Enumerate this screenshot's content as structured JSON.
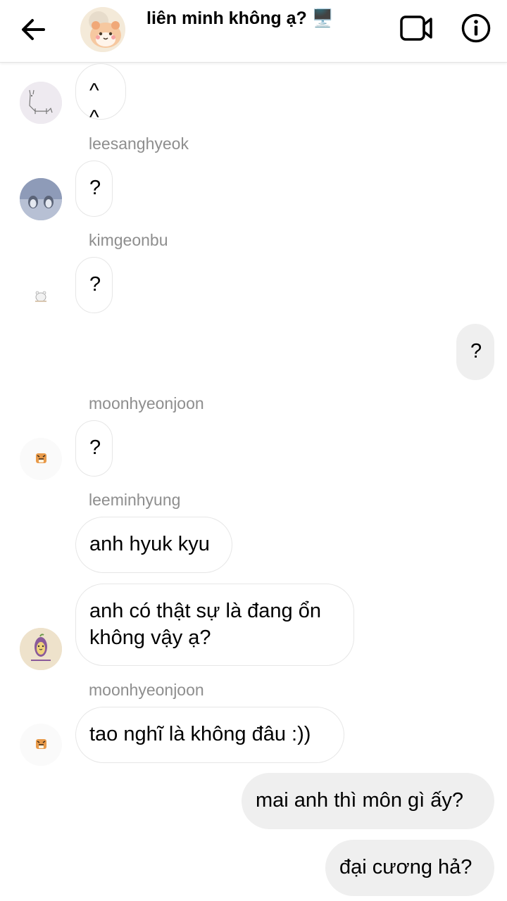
{
  "header": {
    "back_icon": "arrow-left-icon",
    "group_avatar_icon": "hamster-avatar-icon",
    "title": "liên minh không ạ? 🖥️",
    "subtitle": "",
    "video_icon": "video-call-icon",
    "info_icon": "info-icon"
  },
  "messages": [
    {
      "text": "^ ^",
      "direction": "incoming",
      "avatar_icon": "alpaca-avatar-icon"
    },
    {
      "sender": "leesanghyeok",
      "text": "?",
      "direction": "incoming",
      "avatar_icon": "penguins-avatar-icon"
    },
    {
      "sender": "kimgeonbu",
      "text": "?",
      "direction": "incoming",
      "avatar_icon": "white-bear-avatar-icon"
    },
    {
      "text": "?",
      "direction": "outgoing"
    },
    {
      "sender": "moonhyeonjoon",
      "text": "?",
      "direction": "incoming",
      "avatar_icon": "tiger-avatar-icon"
    },
    {
      "sender": "leeminhyung",
      "text": "anh hyuk kyu",
      "direction": "incoming"
    },
    {
      "text": "anh có thật sự là đang ổn không vậy ạ?",
      "direction": "incoming",
      "avatar_icon": "sweet-potato-avatar-icon"
    },
    {
      "sender": "moonhyeonjoon",
      "text": "tao nghĩ là không đâu :))",
      "direction": "incoming",
      "avatar_icon": "tiger-avatar-icon"
    },
    {
      "text": "mai anh thì môn gì ấy?",
      "direction": "outgoing"
    },
    {
      "text": "đại cương hả?",
      "direction": "outgoing"
    }
  ],
  "colors": {
    "outgoing_bubble": "#efefef",
    "incoming_border": "#e6e6e6",
    "sender_label": "#8e8e8e"
  }
}
